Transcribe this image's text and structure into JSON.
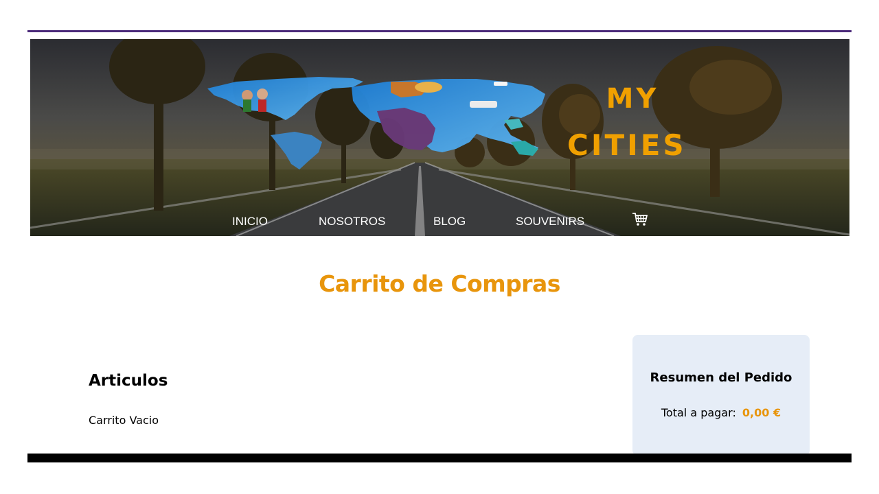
{
  "colors": {
    "brand_orange": "#e8950c",
    "header_rule": "#4b2a7a",
    "summary_bg": "#e6edf7",
    "footer_bar": "#000000"
  },
  "header": {
    "brand_line1": "MY",
    "brand_line2": "CITIES",
    "nav": {
      "items": [
        {
          "label": "INICIO"
        },
        {
          "label": "NOSOTROS"
        },
        {
          "label": "BLOG"
        },
        {
          "label": "SOUVENIRS"
        }
      ],
      "cart_icon": "shopping-cart-icon"
    }
  },
  "main": {
    "title": "Carrito de Compras",
    "articles": {
      "heading": "Articulos",
      "empty_message": "Carrito Vacio"
    },
    "summary": {
      "title": "Resumen del Pedido",
      "total_label": "Total a pagar:",
      "total_value": "0,00 €"
    }
  }
}
